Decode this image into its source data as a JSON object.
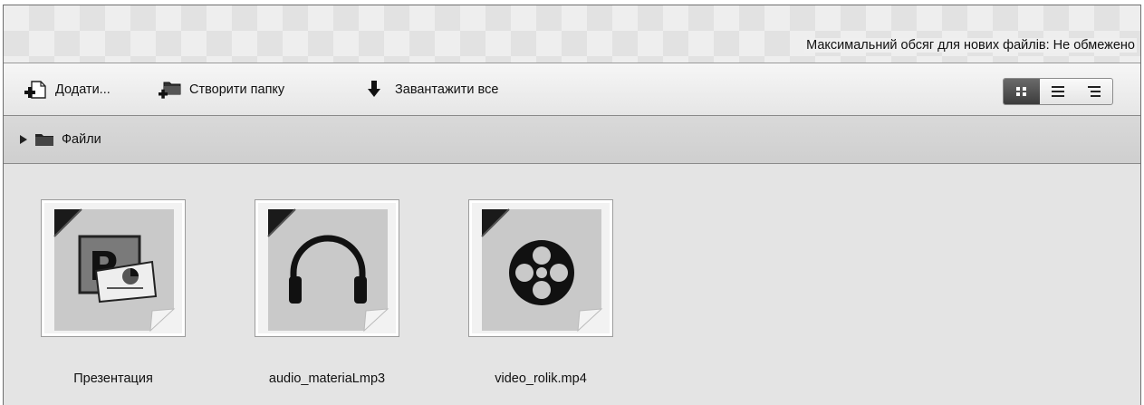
{
  "header": {
    "quota_text": "Максимальний обсяг для нових файлів: Не обмежено"
  },
  "toolbar": {
    "add_label": "Додати...",
    "add_icon": "add-file-icon",
    "create_folder_label": "Створити папку",
    "create_folder_icon": "new-folder-icon",
    "download_all_label": "Завантажити все",
    "download_all_icon": "download-arrow-icon",
    "view_modes": [
      "icons",
      "list",
      "tree"
    ],
    "active_view": "icons"
  },
  "breadcrumb": {
    "items": [
      {
        "label": "Файли",
        "icon": "folder-icon"
      }
    ]
  },
  "files": [
    {
      "name": "Презентация",
      "icon": "powerpoint-icon"
    },
    {
      "name": "audio_materiaLmp3",
      "icon": "headphones-icon"
    },
    {
      "name": "video_rolik.mp4",
      "icon": "film-reel-icon"
    }
  ],
  "colors": {
    "icon_dark": "#111111",
    "thumb_bg": "#c8c8c8",
    "active_view_bg": "#4a4a4a"
  }
}
